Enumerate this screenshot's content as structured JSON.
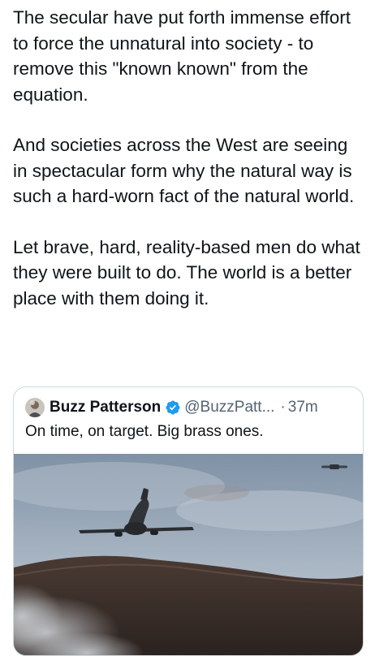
{
  "post": {
    "paragraphs": [
      "The secular have put forth immense effort to force the unnatural into society - to remove this \"known known\" from the equation.",
      "And societies across the West are seeing in spectacular form why the natural way is such a hard-worn fact of the natural world.",
      "Let brave, hard, reality-based men do what they were built to do. The world is a better place with them doing it."
    ]
  },
  "quoted_post": {
    "author_name": "Buzz Patterson",
    "verified_icon": "verified-badge-icon",
    "handle": "@BuzzPatt...",
    "separator": "·",
    "time": "37m",
    "text": "On time, on target. Big brass ones.",
    "media": {
      "type": "video-still",
      "subject": "airliner-low-flyby-over-hill",
      "sky_color": "#8fa0b4",
      "ground_color": "#3b2e2a"
    }
  },
  "colors": {
    "text": "#0f1419",
    "muted": "#536471",
    "verified_blue": "#1d9bf0",
    "card_border": "#cfd9de"
  }
}
